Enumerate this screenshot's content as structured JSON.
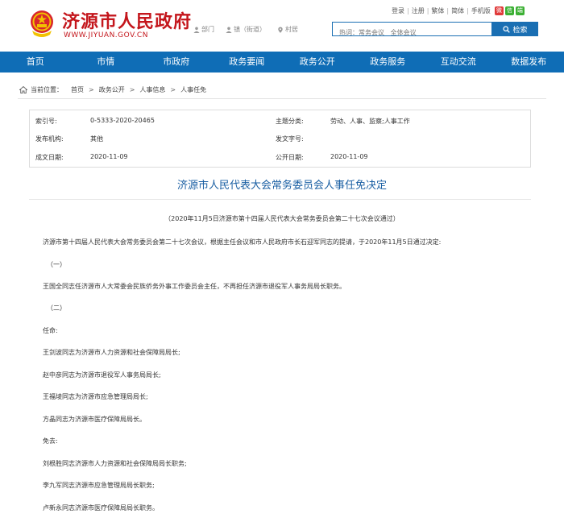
{
  "header": {
    "site_name": "济源市人民政府",
    "site_url": "WWW.JIYUAN.GOV.CN",
    "dept_links": [
      {
        "label": "部门",
        "icon": "person-icon"
      },
      {
        "label": "镇（街道）",
        "icon": "person-icon"
      },
      {
        "label": "村居",
        "icon": "location-icon"
      }
    ],
    "top_links": [
      "登录",
      "注册",
      "繁体",
      "简体",
      "手机版"
    ],
    "social": [
      {
        "icon": "weibo-icon",
        "glyph": "微",
        "color": "#e03a3a"
      },
      {
        "icon": "wechat-icon",
        "glyph": "信",
        "color": "#3cb034"
      },
      {
        "icon": "app-icon",
        "glyph": "端",
        "color": "#3cb034"
      }
    ],
    "search_placeholder": "热词：常务会议   全体会议",
    "search_button": "检索"
  },
  "nav": [
    "首页",
    "市情",
    "市政府",
    "政务要闻",
    "政务公开",
    "政务服务",
    "互动交流",
    "数据发布"
  ],
  "breadcrumb": {
    "prefix": "当前位置：",
    "items": [
      "首页",
      "政务公开",
      "人事信息",
      "人事任免"
    ]
  },
  "meta": {
    "index_label": "索引号:",
    "index_value": "0-5333-2020-20465",
    "topic_label": "主题分类:",
    "topic_value": "劳动、人事、监察;人事工作",
    "org_label": "发布机构:",
    "org_value": "其他",
    "doc_label": "发文字号:",
    "doc_value": "",
    "created_label": "成文日期:",
    "created_value": "2020-11-09",
    "published_label": "公开日期:",
    "published_value": "2020-11-09"
  },
  "article": {
    "title": "济源市人民代表大会常务委员会人事任免决定",
    "subhead": "（2020年11月5日济源市第十四届人民代表大会常务委员会第二十七次会议通过）",
    "paragraphs": [
      "济源市第十四届人民代表大会常务委员会第二十七次会议，根据主任会议和市人民政府市长石迎军同志的提请，于2020年11月5日通过决定:",
      "（一）",
      "王国全同志任济源市人大常委会民族侨务外事工作委员会主任，不再担任济源市退役军人事务局局长职务。",
      "（二）",
      "任命:",
      "王剑波同志为济源市人力资源和社会保障局局长;",
      "赵中彦同志为济源市退役军人事务局局长;",
      "王福堎同志为济源市应急管理局局长;",
      "方晶同志为济源市医疗保障局局长。",
      "免去:",
      "刘根胜同志济源市人力资源和社会保障局局长职务;",
      "李九军同志济源市应急管理局局长职务;",
      "卢新永同志济源市医疗保障局局长职务。"
    ]
  },
  "colors": {
    "brand_red": "#c4161c",
    "nav_blue": "#0f6db6",
    "title_blue": "#1a5fa3"
  }
}
